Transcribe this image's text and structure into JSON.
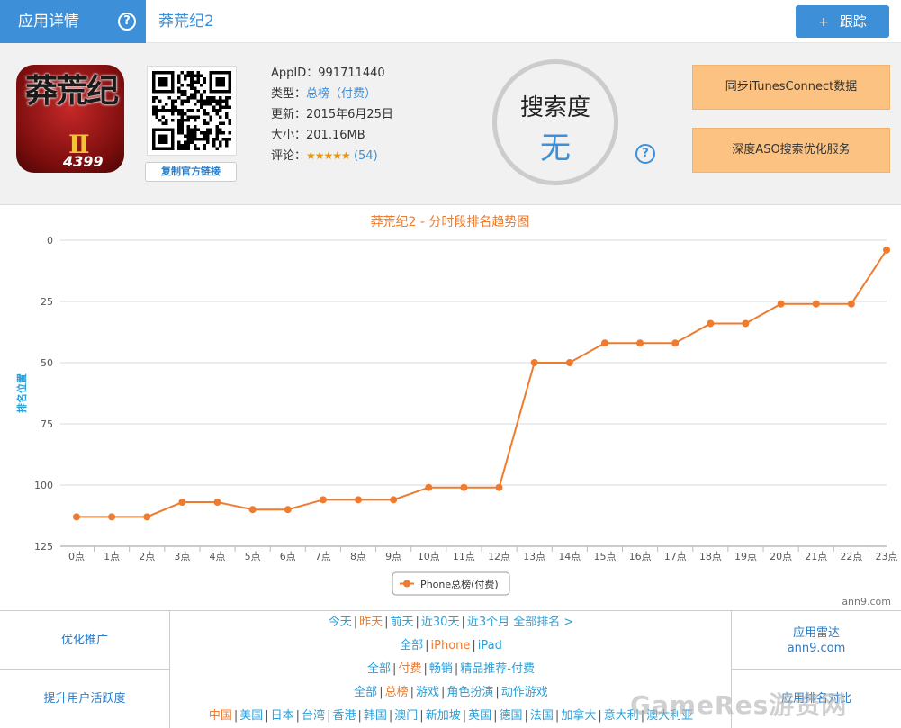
{
  "header": {
    "tab_label": "应用详情",
    "help_glyph": "?",
    "app_name": "莽荒纪2",
    "follow_plus": "+",
    "follow_label": "跟踪"
  },
  "app": {
    "icon_chars": "莽荒纪",
    "icon_roman": "Ⅱ",
    "icon_brand": "4399",
    "copy_link_label": "复制官方链接",
    "appid_label": "AppID：",
    "appid": "991711440",
    "type_label": "类型：",
    "type_value": "总榜（付费）",
    "updated_label": "更新：",
    "updated_value": "2015年6月25日",
    "size_label": "大小：",
    "size_value": "201.16MB",
    "rating_label": "评论：",
    "rating_stars": "★★★★★",
    "rating_value": 4.5,
    "rating_count": "(54)"
  },
  "search": {
    "label": "搜索度",
    "value": "无",
    "help_glyph": "?"
  },
  "actions": {
    "sync_label": "同步iTunesConnect数据",
    "aso_label": "深度ASO搜索优化服务"
  },
  "chart_data": {
    "type": "line",
    "title": "莽荒纪2 - 分时段排名趋势图",
    "xlabel": "",
    "ylabel": "排名位置",
    "categories": [
      "0点",
      "1点",
      "2点",
      "3点",
      "4点",
      "5点",
      "6点",
      "7点",
      "8点",
      "9点",
      "10点",
      "11点",
      "12点",
      "13点",
      "14点",
      "15点",
      "16点",
      "17点",
      "18点",
      "19点",
      "20点",
      "21点",
      "22点",
      "23点"
    ],
    "series": [
      {
        "name": "iPhone总榜(付费)",
        "values": [
          113,
          113,
          113,
          107,
          107,
          110,
          110,
          106,
          106,
          106,
          101,
          101,
          101,
          50,
          50,
          42,
          42,
          42,
          34,
          34,
          26,
          26,
          26,
          4
        ]
      }
    ],
    "ylim": [
      0,
      125
    ],
    "yticks": [
      0,
      25,
      50,
      75,
      100,
      125
    ],
    "y_reversed": true,
    "grid": true,
    "legend": "bottom",
    "credit": "ann9.com",
    "line_color": "#ee7b2e",
    "title_color": "#ee7b2e",
    "ylabel_color": "#2a9fd8"
  },
  "bottom": {
    "left": [
      "优化推广",
      "提升用户活跃度"
    ],
    "right_top_title": "应用雷达",
    "right_top_sub": "ann9.com",
    "right_bottom": "应用排名对比",
    "rows": [
      [
        {
          "t": "今天",
          "hot": false
        },
        {
          "t": "昨天",
          "hot": true
        },
        {
          "t": "前天",
          "hot": false
        },
        {
          "t": "近30天",
          "hot": false
        },
        {
          "t": "近3个月",
          "hot": false
        },
        {
          "t": "全部排名 >",
          "hot": false,
          "nosep": true
        }
      ],
      [
        {
          "t": "全部",
          "hot": false
        },
        {
          "t": "iPhone",
          "hot": true
        },
        {
          "t": "iPad",
          "hot": false
        }
      ],
      [
        {
          "t": "全部",
          "hot": false
        },
        {
          "t": "付费",
          "hot": true
        },
        {
          "t": "畅销",
          "hot": false
        },
        {
          "t": "精品推荐-付费",
          "hot": false
        }
      ],
      [
        {
          "t": "全部",
          "hot": false
        },
        {
          "t": "总榜",
          "hot": true
        },
        {
          "t": "游戏",
          "hot": false
        },
        {
          "t": "角色扮演",
          "hot": false
        },
        {
          "t": "动作游戏",
          "hot": false
        }
      ],
      [
        {
          "t": "中国",
          "hot": true
        },
        {
          "t": "美国",
          "hot": false
        },
        {
          "t": "日本",
          "hot": false
        },
        {
          "t": "台湾",
          "hot": false
        },
        {
          "t": "香港",
          "hot": false
        },
        {
          "t": "韩国",
          "hot": false
        },
        {
          "t": "澳门",
          "hot": false
        },
        {
          "t": "新加坡",
          "hot": false
        },
        {
          "t": "英国",
          "hot": false
        },
        {
          "t": "德国",
          "hot": false
        },
        {
          "t": "法国",
          "hot": false
        },
        {
          "t": "加拿大",
          "hot": false
        },
        {
          "t": "意大利",
          "hot": false
        },
        {
          "t": "澳大利亚",
          "hot": false
        }
      ]
    ],
    "separator": "|",
    "watermark": "GameRes游资网"
  }
}
